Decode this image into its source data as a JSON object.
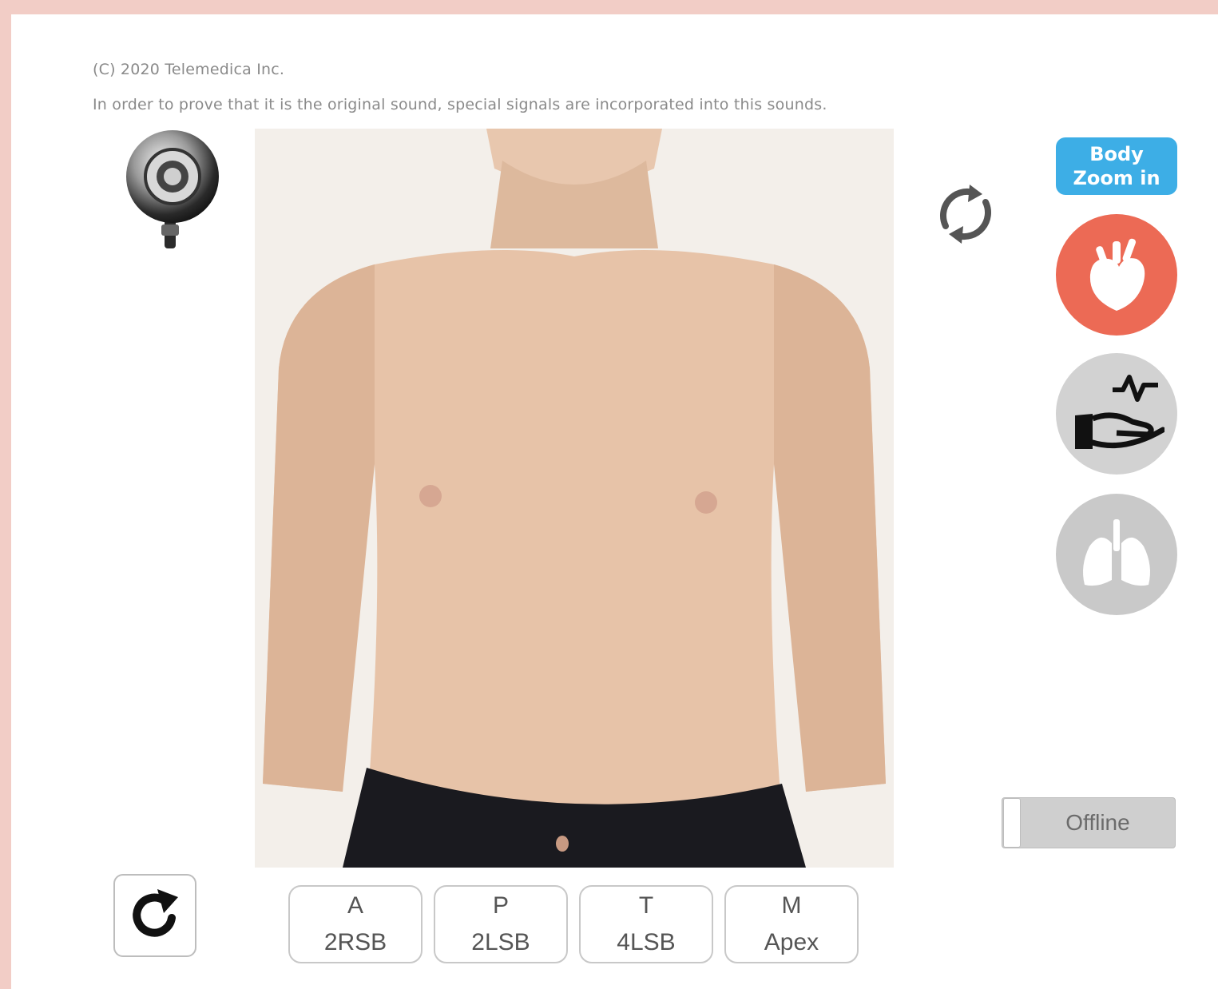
{
  "header": {
    "copyright": "(C) 2020 Telemedica Inc.",
    "notice": "In order to prove that it is the original sound, special signals are incorporated into this sounds."
  },
  "controls": {
    "zoom_line1": "Body",
    "zoom_line2": "Zoom in",
    "offline_label": "Offline"
  },
  "icons": {
    "stethoscope": "stethoscope-icon",
    "rotate": "rotate-icon",
    "heart": "heart-icon",
    "pulse": "pulse-hand-icon",
    "lungs": "lungs-icon",
    "reload": "reload-icon"
  },
  "colors": {
    "frame": "#f2cdc6",
    "zoom_button": "#3daee6",
    "heart_active": "#ec6a55",
    "inactive_gray": "#d2d2d2"
  },
  "auscultation_sites": [
    {
      "letter": "A",
      "location": "2RSB"
    },
    {
      "letter": "P",
      "location": "2LSB"
    },
    {
      "letter": "T",
      "location": "4LSB"
    },
    {
      "letter": "M",
      "location": "Apex"
    }
  ]
}
